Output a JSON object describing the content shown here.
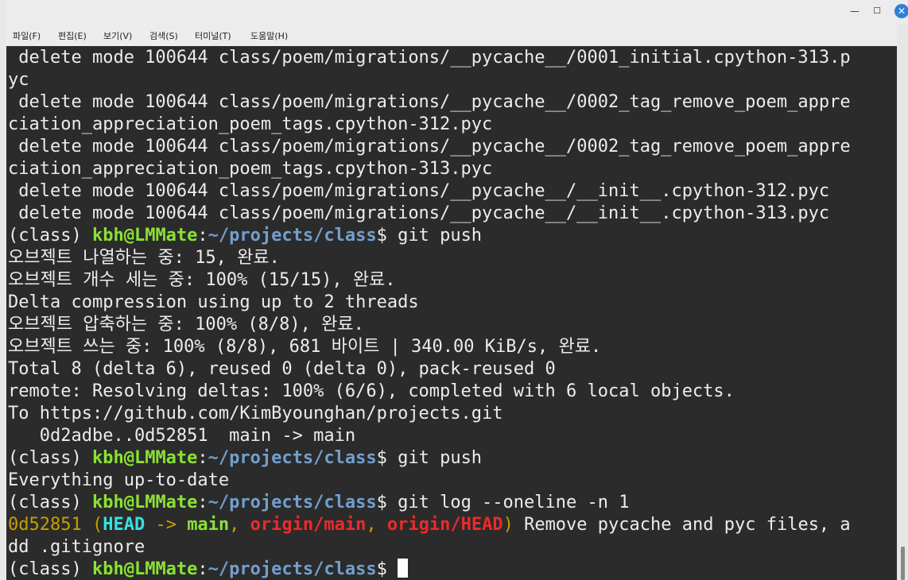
{
  "window": {
    "menu": [
      "파일(F)",
      "편집(E)",
      "보기(V)",
      "검색(S)",
      "터미널(T)",
      "도움말(H)"
    ]
  },
  "prompt": {
    "env": "(class) ",
    "userhost": "kbh@LMMate",
    "colon": ":",
    "path": "~/projects/class",
    "symbol": "$ "
  },
  "terminal": {
    "l0": " delete mode 100644 class/poem/migrations/__pycache__/0001_initial.cpython-313.p",
    "l1": "yc",
    "l2": " delete mode 100644 class/poem/migrations/__pycache__/0002_tag_remove_poem_appre",
    "l3": "ciation_appreciation_poem_tags.cpython-312.pyc",
    "l4": " delete mode 100644 class/poem/migrations/__pycache__/0002_tag_remove_poem_appre",
    "l5": "ciation_appreciation_poem_tags.cpython-313.pyc",
    "l6": " delete mode 100644 class/poem/migrations/__pycache__/__init__.cpython-312.pyc",
    "l7": " delete mode 100644 class/poem/migrations/__pycache__/__init__.cpython-313.pyc",
    "cmd1": "git push",
    "l9": "오브젝트 나열하는 중: 15, 완료.",
    "l10": "오브젝트 개수 세는 중: 100% (15/15), 완료.",
    "l11": "Delta compression using up to 2 threads",
    "l12": "오브젝트 압축하는 중: 100% (8/8), 완료.",
    "l13": "오브젝트 쓰는 중: 100% (8/8), 681 바이트 | 340.00 KiB/s, 완료.",
    "l14": "Total 8 (delta 6), reused 0 (delta 0), pack-reused 0",
    "l15": "remote: Resolving deltas: 100% (6/6), completed with 6 local objects.",
    "l16": "To https://github.com/KimByounghan/projects.git",
    "l17": "   0d2adbe..0d52851  main -> main",
    "cmd2": "git push",
    "l19": "Everything up-to-date",
    "cmd3": "git log --oneline -n 1",
    "log": {
      "hash": "0d52851",
      "open": " (",
      "head": "HEAD",
      "arrow": " -> ",
      "branch": "main",
      "sep1": ", ",
      "origin_main": "origin/main",
      "sep2": ", ",
      "origin_head": "origin/HEAD",
      "close": ")",
      "message": " Remove pycache and pyc files, a",
      "message_cont": "dd .gitignore"
    }
  }
}
